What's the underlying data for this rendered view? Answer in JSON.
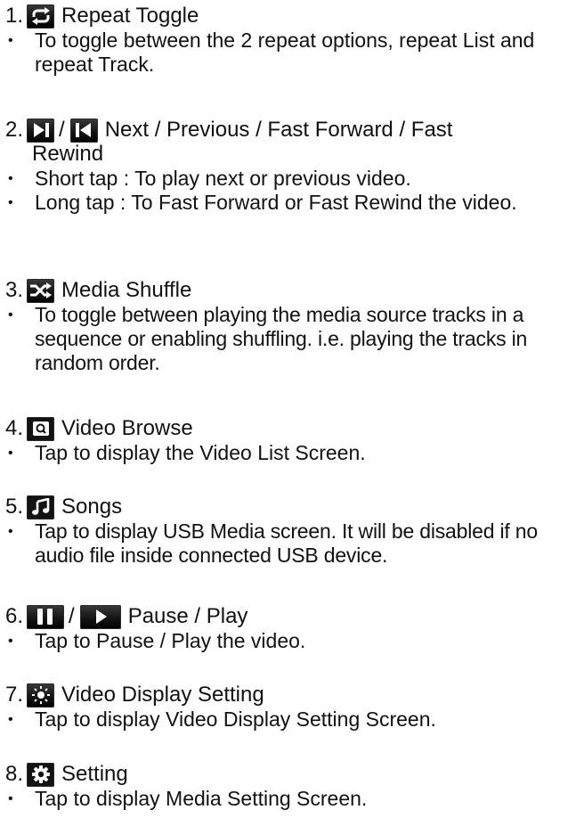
{
  "items": [
    {
      "num": "1.",
      "icon": "repeat-icon",
      "title": "Repeat Toggle",
      "bullets": [
        "To toggle between the 2 repeat options, repeat List and repeat Track."
      ]
    },
    {
      "num": "2.",
      "icon": "next-icon",
      "separator": "/",
      "icon2": "previous-icon",
      "title": "Next / Previous / Fast Forward / Fast",
      "title_cont": "Rewind",
      "bullets": [
        "Short tap : To play next or previous video.",
        "Long tap : To Fast Forward or Fast Rewind the video."
      ]
    },
    {
      "num": "3.",
      "icon": "shuffle-icon",
      "title": "Media Shuffle",
      "bullets": [
        "To toggle between playing the media source tracks in a sequence or enabling shuffling. i.e. playing the tracks in random order."
      ]
    },
    {
      "num": "4.",
      "icon": "video-browse-icon",
      "title": "Video Browse",
      "bullets": [
        "Tap to display the Video List Screen."
      ]
    },
    {
      "num": "5.",
      "icon": "music-note-icon",
      "title": "Songs",
      "bullets": [
        "Tap to display USB Media screen. It will be disabled if no audio file inside connected USB device."
      ]
    },
    {
      "num": "6.",
      "icon": "pause-icon",
      "separator": "/",
      "icon2": "play-icon",
      "title": "Pause / Play",
      "bullets": [
        "Tap to Pause / Play the video."
      ]
    },
    {
      "num": "7.",
      "icon": "brightness-icon",
      "title": "Video Display Setting",
      "bullets": [
        "Tap to display Video Display Setting Screen."
      ]
    },
    {
      "num": "8.",
      "icon": "gear-icon",
      "title": "Setting",
      "bullets": [
        "Tap to display Media Setting Screen."
      ]
    }
  ]
}
